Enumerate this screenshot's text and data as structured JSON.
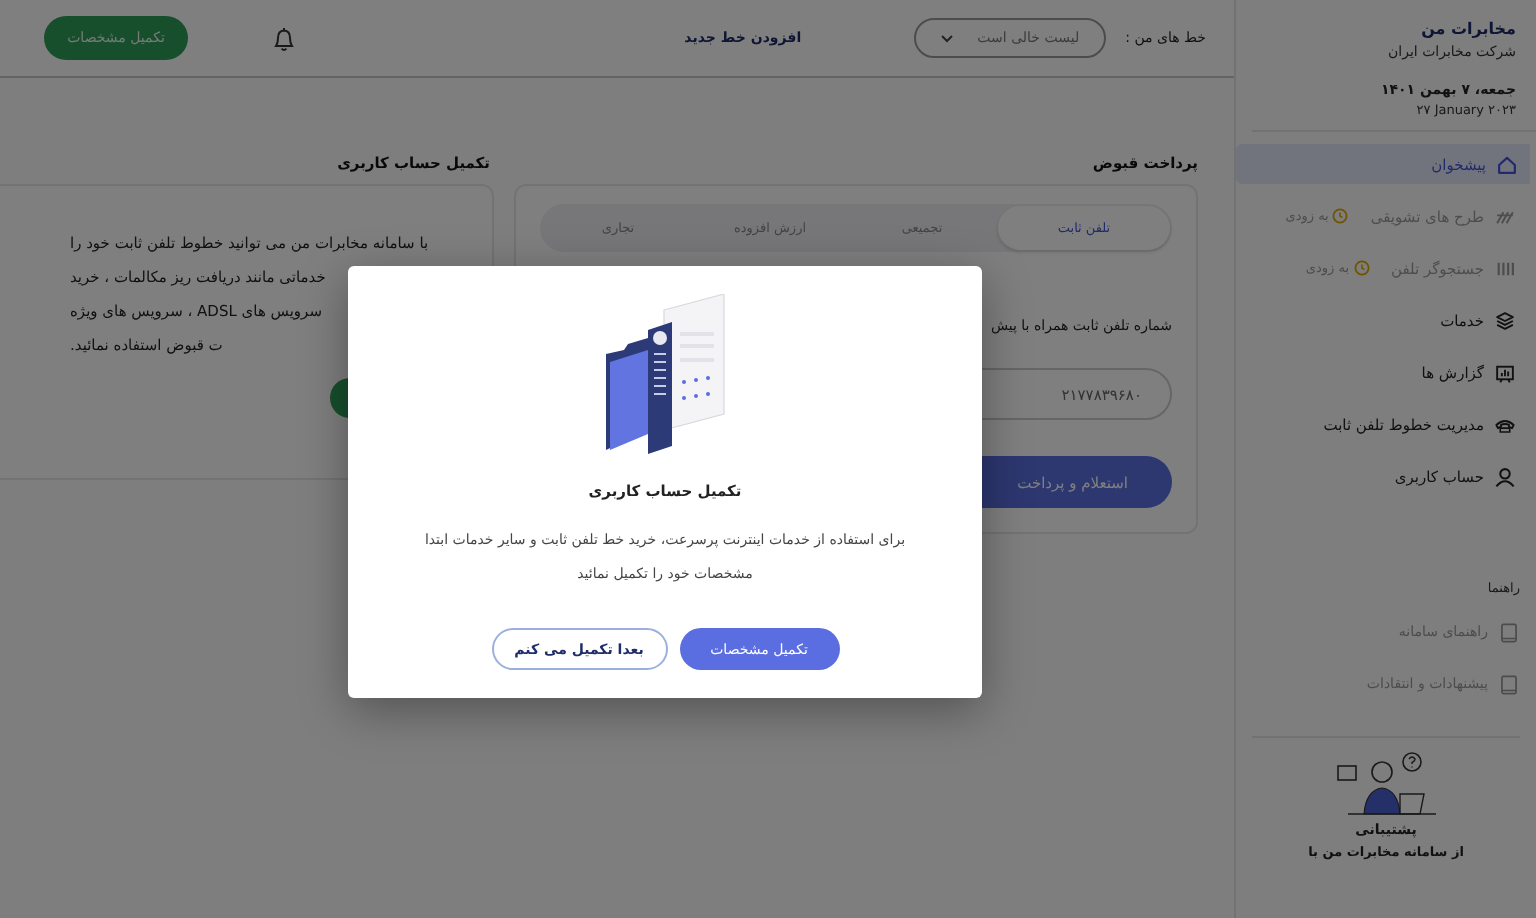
{
  "sidebar": {
    "brand": "مخابرات من",
    "company": "شرکت مخابرات ایران",
    "date": "جمعه، ۷ بهمن ۱۴۰۱",
    "date_gregorian": "۲۷ January ۲۰۲۳",
    "items": [
      {
        "label": "پیشخوان",
        "kind": "home",
        "selected": true,
        "disabled": false
      },
      {
        "label": "طرح های تشویقی",
        "kind": "gift",
        "selected": false,
        "disabled": true,
        "badge": "به زودی"
      },
      {
        "label": "جستجوگر تلفن",
        "kind": "bars",
        "selected": false,
        "disabled": true,
        "badge": "به زودی"
      },
      {
        "label": "خدمات",
        "kind": "layers",
        "selected": false,
        "disabled": false
      },
      {
        "label": "گزارش ها",
        "kind": "report",
        "selected": false,
        "disabled": false
      },
      {
        "label": "مدیریت خطوط تلفن ثابت",
        "kind": "phone",
        "selected": false,
        "disabled": false
      },
      {
        "label": "حساب کاربری",
        "kind": "user",
        "selected": false,
        "disabled": false
      }
    ],
    "help_title": "راهنما",
    "help_items": [
      {
        "label": "راهنمای سامانه",
        "disabled": true
      },
      {
        "label": "پیشنهادات و انتقادات",
        "disabled": true
      }
    ],
    "support": {
      "title": "پشتیبانی",
      "subtitle": "از سامانه مخابرات من با"
    }
  },
  "header": {
    "lines_label": "خط های من :",
    "lines_placeholder": "لیست خالی است",
    "add_line": "افزودن خط جدید",
    "complete_button": "تکمیل مشخصات"
  },
  "bill_payment": {
    "title": "پرداخت قبوض",
    "tabs": [
      {
        "label": "تلفن ثابت",
        "selected": true
      },
      {
        "label": "تجمیعی",
        "selected": false
      },
      {
        "label": "ارزش افزوده",
        "selected": false
      },
      {
        "label": "تجاری",
        "selected": false
      }
    ],
    "field_label": "شماره تلفن ثابت همراه با پیش",
    "phone": "۲۱۷۷۸۳۹۶۸۰",
    "submit": "استعلام و پرداخت"
  },
  "account_card": {
    "title": "تکمیل حساب کاربری",
    "lines": [
      "با سامانه مخابرات من می توانید خطوط تلفن ثابت خود را",
      "خدماتی مانند دریافت ریز مکالمات ، خرید",
      "سرویس های ADSL ، سرویس های ویژه",
      "ت قبوض استفاده نمائید."
    ]
  },
  "modal": {
    "title": "تکمیل حساب کاربری",
    "text": "برای استفاده از خدمات اینترنت پرسرعت، خرید خط تلفن ثابت و سایر خدمات ابتدا مشخصات خود را تکمیل نمائید",
    "primary": "تکمیل مشخصات",
    "secondary": "بعدا تکمیل می کنم"
  }
}
